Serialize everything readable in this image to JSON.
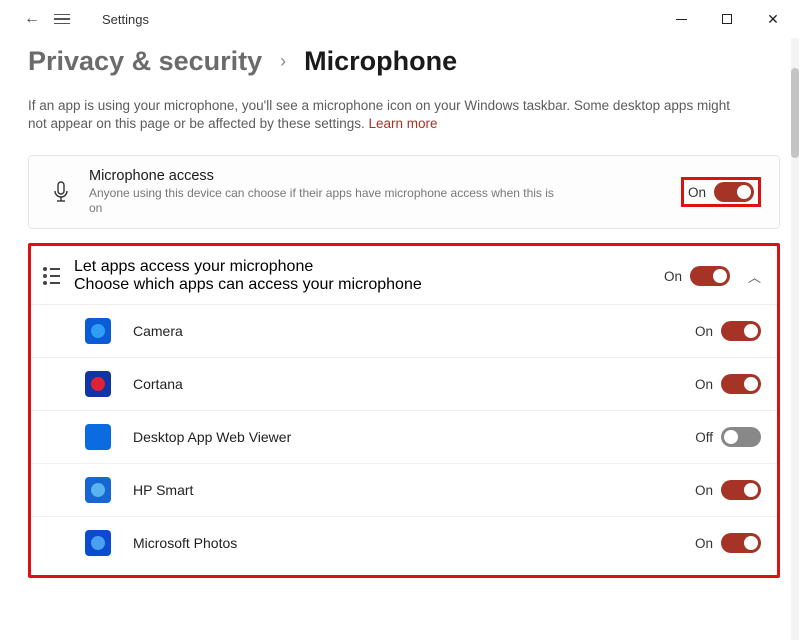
{
  "app_title": "Settings",
  "breadcrumb": {
    "parent": "Privacy & security",
    "sep": "›",
    "current": "Microphone"
  },
  "description": "If an app is using your microphone, you'll see a microphone icon on your Windows taskbar. Some desktop apps might not appear on this page or be affected by these settings.  ",
  "learn_more": "Learn more",
  "mic_access": {
    "title": "Microphone access",
    "sub": "Anyone using this device can choose if their apps have microphone access when this is on",
    "state": "On",
    "on": true
  },
  "apps_access": {
    "title": "Let apps access your microphone",
    "sub": "Choose which apps can access your microphone",
    "state": "On",
    "on": true
  },
  "apps": [
    {
      "name": "Camera",
      "state": "On",
      "on": true,
      "color": "#0a5bd6",
      "inner": "#2f9ff5"
    },
    {
      "name": "Cortana",
      "state": "On",
      "on": true,
      "color": "#1035a6",
      "inner": "#d23"
    },
    {
      "name": "Desktop App Web Viewer",
      "state": "Off",
      "on": false,
      "color": "#0b6be0",
      "inner": ""
    },
    {
      "name": "HP Smart",
      "state": "On",
      "on": true,
      "color": "#1866d4",
      "inner": "#5ab4f0"
    },
    {
      "name": "Microsoft Photos",
      "state": "On",
      "on": true,
      "color": "#0b4bd0",
      "inner": "#4aa0f0"
    }
  ]
}
